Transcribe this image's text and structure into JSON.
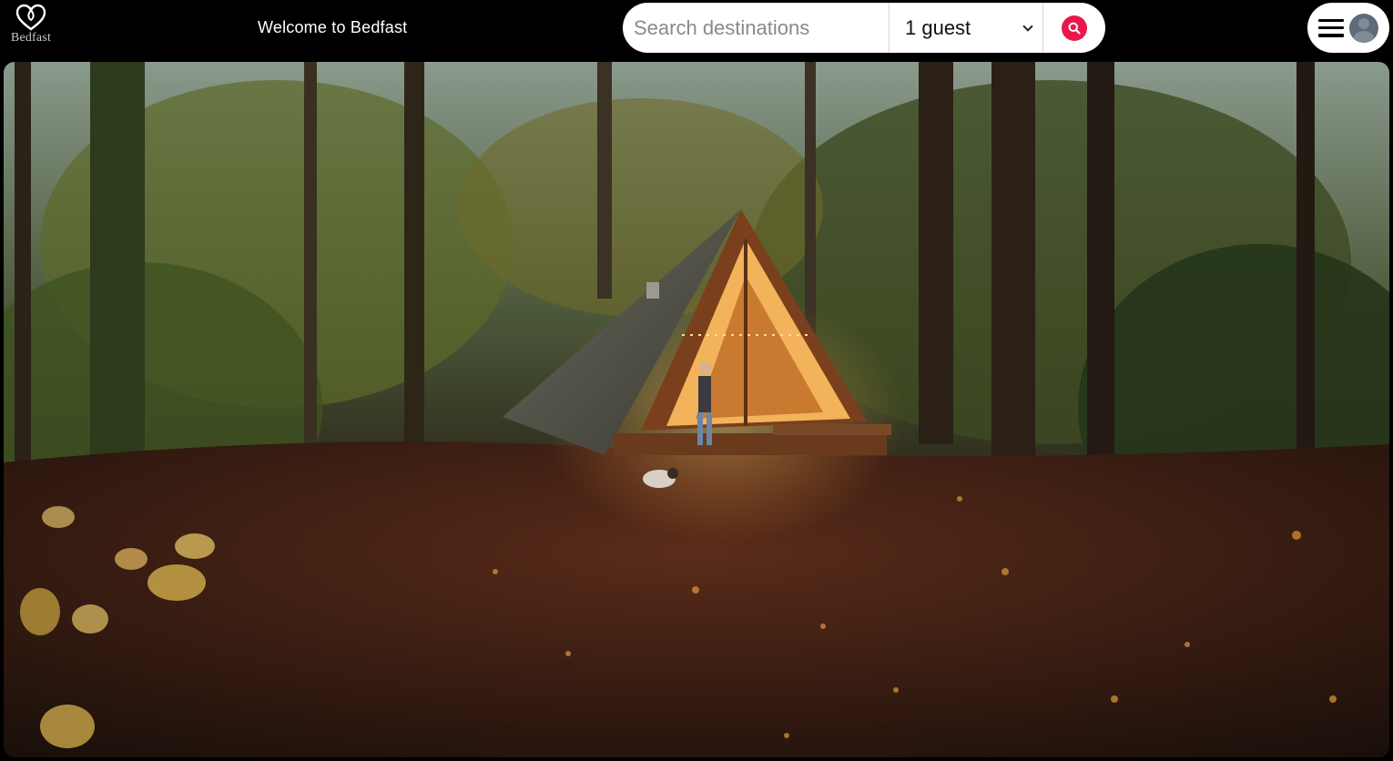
{
  "brand": {
    "name": "Bedfast",
    "icon": "heart-logo-icon"
  },
  "header": {
    "welcome": "Welcome to Bedfast"
  },
  "search": {
    "placeholder": "Search destinations",
    "guest_selected": "1 guest",
    "button_icon": "search-icon"
  },
  "menu": {
    "icon": "hamburger-icon",
    "avatar": "user-avatar-icon"
  },
  "hero": {
    "subject": "A-frame cabin in autumn forest at dusk"
  },
  "colors": {
    "accent": "#e8174d",
    "nav_bg": "#000000"
  }
}
